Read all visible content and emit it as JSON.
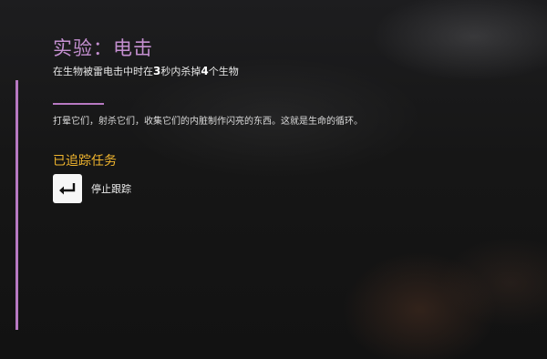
{
  "challenge": {
    "title": "实验：电击",
    "subtitle_parts": {
      "a": "在生物被雷电击中时在",
      "num1": "3",
      "b": "秒内杀掉",
      "num2": "4",
      "c": "个生物"
    },
    "description": "打晕它们，射杀它们，收集它们的内脏制作闪亮的东西。这就是生命的循环。"
  },
  "tracked": {
    "heading": "已追踪任务",
    "action_label": "停止跟踪",
    "action_icon": "enter-key-icon"
  },
  "colors": {
    "accent": "#b779c2",
    "title": "#c48fd0",
    "heading": "#f0b52e"
  }
}
